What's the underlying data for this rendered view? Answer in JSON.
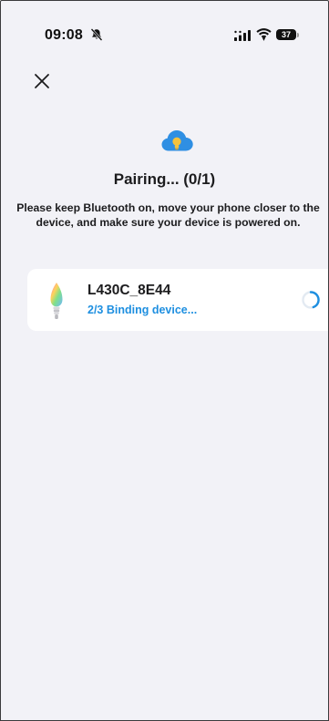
{
  "status_bar": {
    "time": "09:08",
    "battery_level": "37"
  },
  "header": {
    "title": "Pairing... (0/1)",
    "instructions": "Please keep Bluetooth on, move your phone closer to the device, and make sure your device is powered on."
  },
  "device": {
    "name": "L430C_8E44",
    "status": "2/3 Binding device..."
  },
  "colors": {
    "accent": "#1e8fe0",
    "cloud": "#2f8fe3",
    "bulb_glow": "#f5c23c",
    "background": "#f2f2f7",
    "card": "#ffffff"
  },
  "icons": [
    "bell-slash-icon",
    "cellular-signal-icon",
    "wifi-icon",
    "battery-icon",
    "close-icon",
    "cloud-bulb-icon",
    "bulb-icon",
    "spinner-icon"
  ]
}
